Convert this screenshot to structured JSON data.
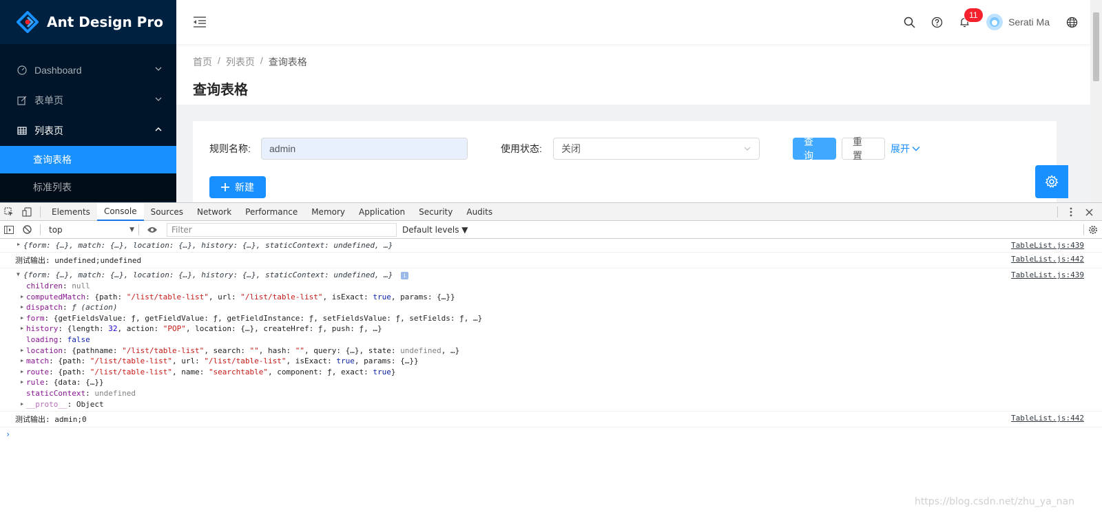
{
  "app": {
    "logo_text": "Ant Design Pro",
    "menu": [
      {
        "label": "Dashboard",
        "icon": "dashboard-icon"
      },
      {
        "label": "表单页",
        "icon": "form-icon"
      },
      {
        "label": "列表页",
        "icon": "table-icon"
      }
    ],
    "submenu": [
      {
        "label": "查询表格",
        "active": true
      },
      {
        "label": "标准列表",
        "active": false
      }
    ],
    "header": {
      "notification_count": "11",
      "user_name": "Serati Ma"
    },
    "breadcrumb": [
      "首页",
      "列表页",
      "查询表格"
    ],
    "breadcrumb_sep": "/",
    "page_title": "查询表格",
    "form": {
      "rule_name_label": "规则名称:",
      "rule_name_value": "admin",
      "status_label": "使用状态:",
      "status_value": "关闭",
      "query_button": "查询",
      "reset_button": "重置",
      "expand_link": "展开",
      "new_button": "新建"
    },
    "colors": {
      "primary": "#1890ff",
      "sider": "#001529",
      "badge": "#f5222d"
    }
  },
  "devtools": {
    "tabs": [
      "Elements",
      "Console",
      "Sources",
      "Network",
      "Performance",
      "Memory",
      "Application",
      "Security",
      "Audits"
    ],
    "active_tab": "Console",
    "context": "top",
    "filter_placeholder": "Filter",
    "levels": "Default levels ▼",
    "logs": {
      "l1_text": "{form: {…}, match: {…}, location: {…}, history: {…}, staticContext: undefined, …}",
      "l1_src": "TableList.js:439",
      "l2_label": "测试输出:",
      "l2_text": " undefined;undefined",
      "l2_src": "TableList.js:442",
      "l3_text": "{form: {…}, match: {…}, location: {…}, history: {…}, staticContext: undefined, …}",
      "l3_src": "TableList.js:439",
      "l4_label": "测试输出:",
      "l4_text": " admin;0",
      "l4_src": "TableList.js:442"
    },
    "props": {
      "children_k": "children",
      "children_v": "null",
      "cm_k": "computedMatch",
      "cm_a": "{path: ",
      "cm_s1": "\"/list/table-list\"",
      "cm_b": ", url: ",
      "cm_s2": "\"/list/table-list\"",
      "cm_c": ", isExact: ",
      "cm_t": "true",
      "cm_d": ", params: {…}}",
      "dispatch_k": "dispatch",
      "dispatch_v": "ƒ (action)",
      "form_k": "form",
      "form_v": "{getFieldsValue: ƒ, getFieldValue: ƒ, getFieldInstance: ƒ, setFieldsValue: ƒ, setFields: ƒ, …}",
      "history_k": "history",
      "history_a": "{length: ",
      "history_n": "32",
      "history_b": ", action: ",
      "history_s": "\"POP\"",
      "history_c": ", location: {…}, createHref: ƒ, push: ƒ, …}",
      "loading_k": "loading",
      "loading_v": "false",
      "location_k": "location",
      "location_a": "{pathname: ",
      "location_s1": "\"/list/table-list\"",
      "location_b": ", search: ",
      "location_s2": "\"\"",
      "location_c": ", hash: ",
      "location_s3": "\"\"",
      "location_d": ", query: {…}, state: ",
      "location_u": "undefined",
      "location_e": ", …}",
      "match_k": "match",
      "match_a": "{path: ",
      "match_s1": "\"/list/table-list\"",
      "match_b": ", url: ",
      "match_s2": "\"/list/table-list\"",
      "match_c": ", isExact: ",
      "match_t": "true",
      "match_d": ", params: {…}}",
      "route_k": "route",
      "route_a": "{path: ",
      "route_s1": "\"/list/table-list\"",
      "route_b": ", name: ",
      "route_s2": "\"searchtable\"",
      "route_c": ", component: ƒ, exact: ",
      "route_t": "true",
      "route_d": "}",
      "rule_k": "rule",
      "rule_v": "{data: {…}}",
      "sc_k": "staticContext",
      "sc_v": "undefined",
      "proto_k": "__proto__",
      "proto_v": "Object"
    },
    "prompt": "›"
  },
  "watermark": "https://blog.csdn.net/zhu_ya_nan"
}
